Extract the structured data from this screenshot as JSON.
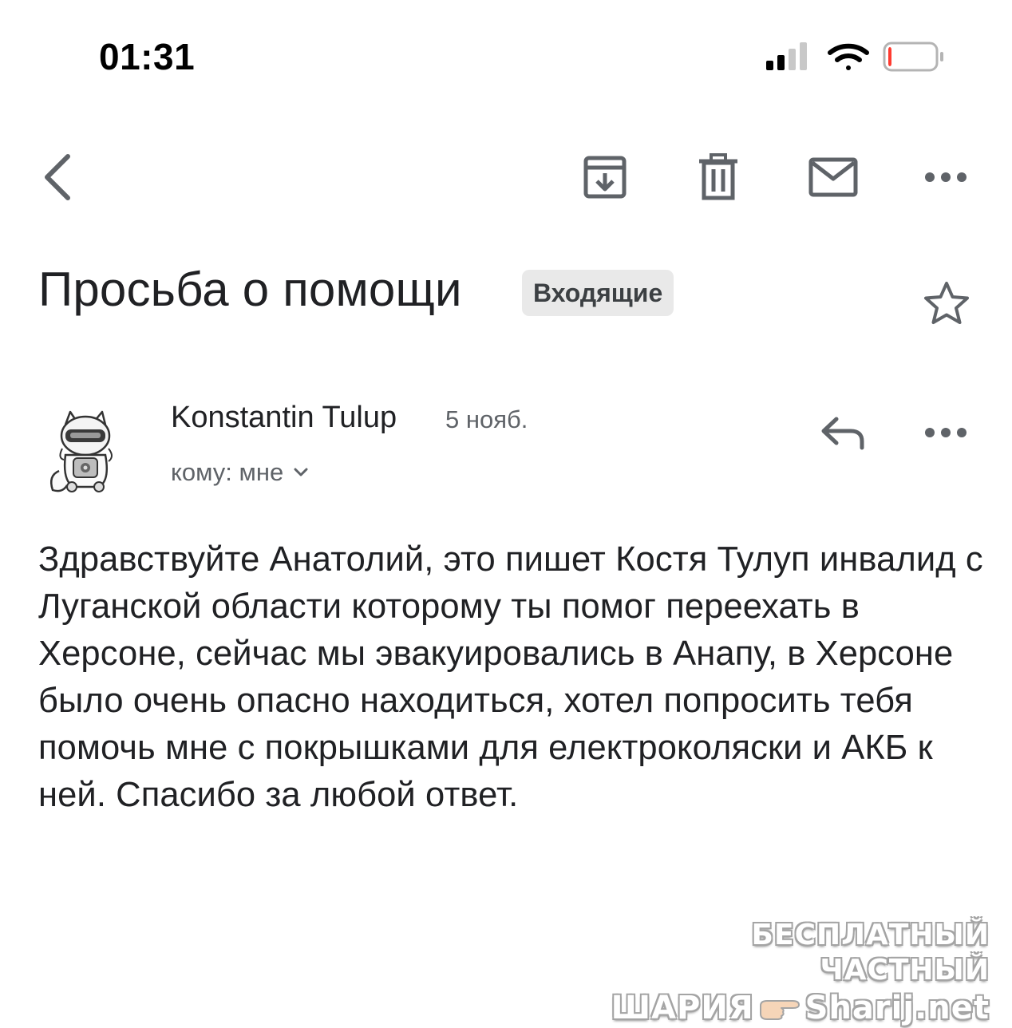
{
  "status_bar": {
    "time": "01:31",
    "signal_icon": "cellular-signal-icon",
    "wifi_icon": "wifi-icon",
    "battery_icon": "battery-low-icon",
    "battery_level": 0.08,
    "battery_color": "#ff3b30"
  },
  "toolbar": {
    "back_icon": "chevron-left-icon",
    "archive_icon": "archive-icon",
    "delete_icon": "trash-icon",
    "mark_unread_icon": "mail-icon",
    "more_icon": "more-horizontal-icon"
  },
  "message": {
    "subject": "Просьба о помощи",
    "label": "Входящие",
    "star_icon": "star-outline-icon",
    "sender_name": "Konstantin Tulup",
    "date": "5 нояб.",
    "recipient": "кому: мне",
    "reply_icon": "reply-icon",
    "body": "Здравствуйте Анатолий, это пишет Костя Тулуп инвалид с Луганской области которому ты помог переехать в Херсоне, сейчас мы эвакуировались в Анапу, в Херсоне было очень опасно находиться, хотел попросить тебя помочь мне с покрышками для електроколяски и АКБ к ней. Спасибо за любой ответ."
  },
  "watermark": {
    "line1": "БЕСПЛАТНЫЙ ЧАСТНЫЙ",
    "line2_left": "ШАРИЯ",
    "line2_right": "Sharij.net"
  },
  "colors": {
    "text_primary": "#202124",
    "text_secondary": "#5f6368",
    "icon_gray": "#5f6368",
    "chip_bg": "#e9e9e9"
  }
}
